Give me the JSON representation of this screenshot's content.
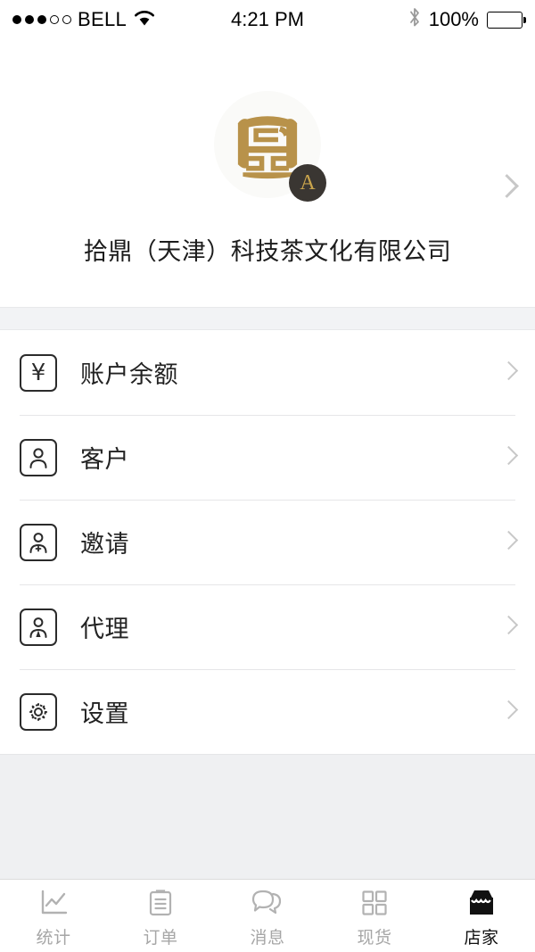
{
  "status_bar": {
    "carrier": "BELL",
    "signal_filled": 3,
    "signal_total": 5,
    "time": "4:21 PM",
    "battery_percent": "100%",
    "wifi_icon": "wifi-icon",
    "bluetooth_icon": "bluetooth-icon",
    "battery_icon": "battery-full-icon"
  },
  "profile": {
    "company_name": "拾鼎（天津）科技茶文化有限公司",
    "logo_badge_letter": "A",
    "logo_icon": "company-seal-logo",
    "chevron_icon": "chevron-right-icon",
    "colors": {
      "logo_gold": "#b8924a",
      "badge_bg": "#3a3632",
      "badge_text": "#c9a44c"
    }
  },
  "menu": {
    "items": [
      {
        "label": "账户余额",
        "icon": "yen-balance-icon",
        "glyph": "¥",
        "name": "account-balance"
      },
      {
        "label": "客户",
        "icon": "person-icon",
        "glyph": "",
        "name": "customers"
      },
      {
        "label": "邀请",
        "icon": "person-add-icon",
        "glyph": "",
        "name": "invite"
      },
      {
        "label": "代理",
        "icon": "person-agent-icon",
        "glyph": "",
        "name": "agent"
      },
      {
        "label": "设置",
        "icon": "gear-icon",
        "glyph": "",
        "name": "settings"
      }
    ],
    "chevron_icon": "chevron-right-icon"
  },
  "tabbar": {
    "active_index": 4,
    "items": [
      {
        "label": "统计",
        "icon": "line-chart-icon",
        "name": "statistics"
      },
      {
        "label": "订单",
        "icon": "clipboard-icon",
        "name": "orders"
      },
      {
        "label": "消息",
        "icon": "chat-bubbles-icon",
        "name": "messages"
      },
      {
        "label": "现货",
        "icon": "grid-icon",
        "name": "stock"
      },
      {
        "label": "店家",
        "icon": "storefront-icon",
        "name": "shop"
      }
    ],
    "colors": {
      "inactive": "#a6a6a6",
      "active": "#111111"
    }
  }
}
